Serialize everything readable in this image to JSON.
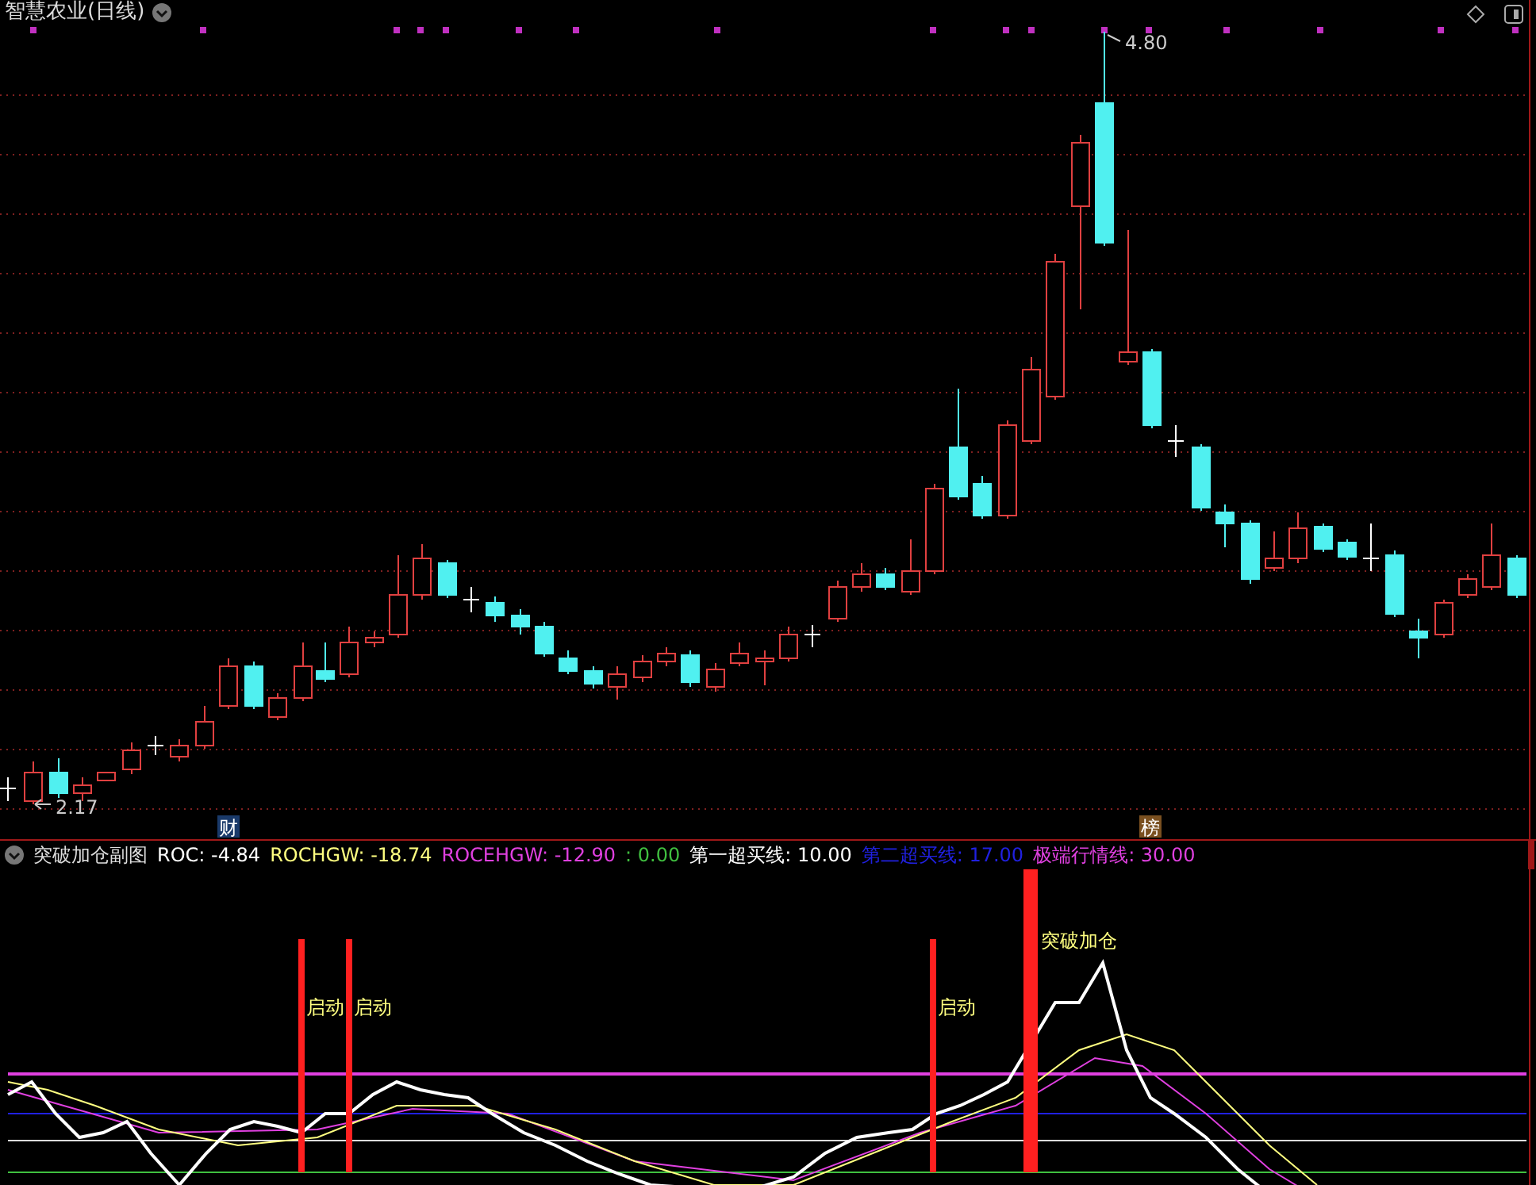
{
  "chart": {
    "title": "智慧农业(日线)",
    "high_label": "4.80",
    "low_label": "2.17",
    "markers": [
      {
        "text": "财",
        "kind": "finance"
      },
      {
        "text": "榜",
        "kind": "ranking"
      }
    ]
  },
  "indicator": {
    "name": "突破加仓副图",
    "values": [
      {
        "text": "ROC: -4.84",
        "color": "#ffffff"
      },
      {
        "text": "ROCHGW: -18.74",
        "color": "#ffff80"
      },
      {
        "text": "ROCEHGW: -12.90",
        "color": "#e040e0"
      },
      {
        "text": ": 0.00",
        "color": "#40c040"
      },
      {
        "text": "第一超买线: 10.00",
        "color": "#ffffff"
      },
      {
        "text": "第二超买线: 17.00",
        "color": "#2020e0"
      },
      {
        "text": "极端行情线: 30.00",
        "color": "#e040e0"
      }
    ],
    "signals": [
      {
        "text": "启动",
        "kind": "start"
      },
      {
        "text": "启动",
        "kind": "start"
      },
      {
        "text": "启动",
        "kind": "start"
      },
      {
        "text": "突破加仓",
        "kind": "breakout"
      }
    ]
  }
}
